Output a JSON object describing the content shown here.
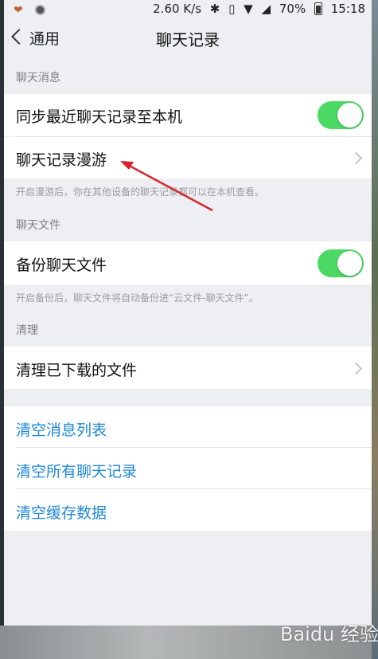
{
  "status_bar": {
    "network_speed": "2.60 K/s",
    "battery": "70%",
    "time": "15:18"
  },
  "nav": {
    "back_label": "通用",
    "title": "聊天记录"
  },
  "sections": {
    "chat_messages": {
      "header": "聊天消息",
      "sync_label": "同步最近聊天记录至本机",
      "roaming_label": "聊天记录漫游",
      "footnote": "开启漫游后，你在其他设备的聊天记录都可以在本机查看。"
    },
    "chat_files": {
      "header": "聊天文件",
      "backup_label": "备份聊天文件",
      "footnote": "开启备份后，聊天文件将自动备份进“云文件-聊天文件”。"
    },
    "cleanup": {
      "header": "清理",
      "clear_downloaded_label": "清理已下载的文件"
    },
    "actions": {
      "clear_message_list": "清空消息列表",
      "clear_all_history": "清空所有聊天记录",
      "clear_cache": "清空缓存数据"
    }
  },
  "toggles": {
    "sync_recent_on": true,
    "backup_files_on": true
  },
  "watermark": "Baidu 经验",
  "colors": {
    "toggle_on": "#4cd964",
    "action_blue": "#1f88d9",
    "arrow_red": "#d6262b"
  }
}
